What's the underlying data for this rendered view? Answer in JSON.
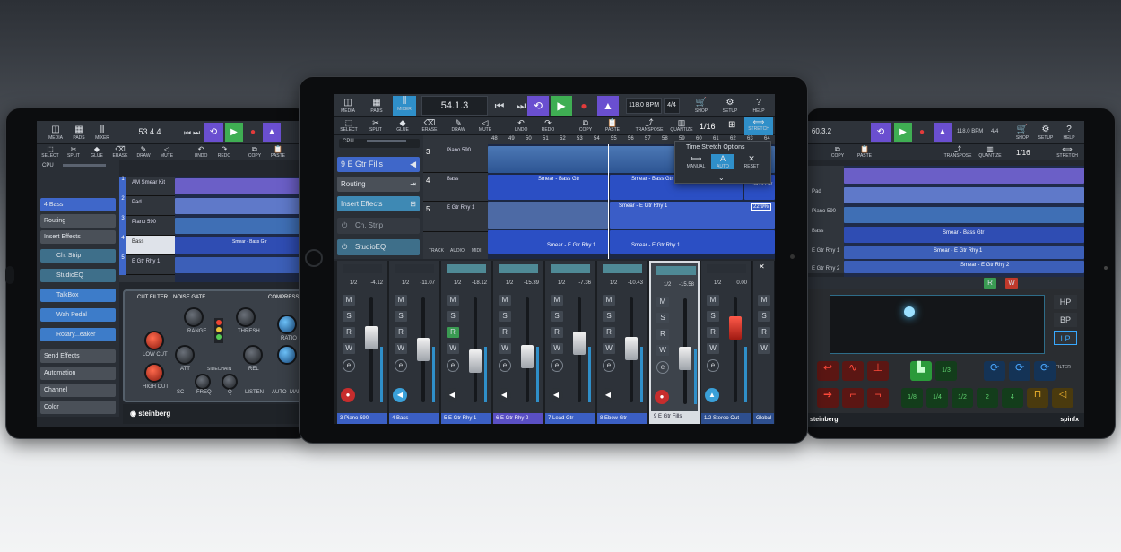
{
  "left": {
    "toolbar": [
      "MEDIA",
      "PADS",
      "MIXER"
    ],
    "position": "53.4.4",
    "tools": [
      "SELECT",
      "SPLIT",
      "GLUE",
      "ERASE",
      "DRAW",
      "MUTE",
      "UNDO",
      "REDO",
      "COPY",
      "PASTE"
    ],
    "cpu": "CPU",
    "track_header": "4 Bass",
    "side_items": [
      "Routing",
      "Insert Effects"
    ],
    "inserts": [
      "Ch. Strip",
      "StudioEQ",
      "TalkBox",
      "Wah Pedal",
      "Rotary...eaker"
    ],
    "side_bottom": [
      "Send Effects",
      "Automation",
      "Channel",
      "Color"
    ],
    "tracks": [
      {
        "num": "1",
        "name": "AM Smear Kit"
      },
      {
        "num": "2",
        "name": "Pad"
      },
      {
        "num": "3",
        "name": "Piano 590"
      },
      {
        "num": "4",
        "name": "Bass"
      },
      {
        "num": "5",
        "name": "E Gtr Rhy 1"
      }
    ],
    "clip_labels": [
      "Smear - Bass Gtr"
    ],
    "plugin_sections": [
      "CUT FILTER",
      "NOISE GATE",
      "COMPRESSOR"
    ],
    "plugin_labels": [
      "LOW CUT",
      "HIGH CUT",
      "RANGE",
      "THRESH",
      "ATT",
      "REL",
      "FREQ",
      "Q",
      "SC",
      "SIDECHAIN",
      "LISTEN",
      "RATIO",
      "AUTO",
      "MAKE"
    ],
    "brand": "steinberg"
  },
  "center": {
    "toolbar": [
      "MEDIA",
      "PADS",
      "MIXER"
    ],
    "position": "54.1.3",
    "tempo": "118.0 BPM",
    "signature": "4/4",
    "right_buttons": [
      "SHOP",
      "SETUP",
      "HELP"
    ],
    "tools": [
      "SELECT",
      "SPLIT",
      "GLUE",
      "ERASE",
      "DRAW",
      "MUTE",
      "UNDO",
      "REDO",
      "COPY",
      "PASTE",
      "TRANSPOSE",
      "QUANTIZE"
    ],
    "grid": "1/16",
    "stretch": "STRETCH",
    "cpu": "CPU",
    "ruler": [
      "48",
      "49",
      "50",
      "51",
      "52",
      "53",
      "54",
      "55",
      "56",
      "57",
      "58",
      "59",
      "60",
      "61",
      "62",
      "63",
      "64"
    ],
    "track_header": "9 E Gtr Fills",
    "side_items": [
      "Routing",
      "Insert Effects"
    ],
    "inserts": [
      "Ch. Strip",
      "StudioEQ"
    ],
    "tracks": [
      {
        "num": "3",
        "name": "Piano 590"
      },
      {
        "num": "4",
        "name": "Bass"
      },
      {
        "num": "5",
        "name": "E Gtr Rhy 1"
      }
    ],
    "bottom_tools": [
      "TRACK",
      "AUDIO",
      "MIDI"
    ],
    "clip_labels": [
      "Smear - Bass Gtr",
      "Smear - Bass Gtr",
      "Smear - Bass Gtr",
      "Smear - E Gtr Rhy 1",
      "Smear - E Gtr Rhy 1",
      "Smear - E Gtr Rhy 1"
    ],
    "stretch_value": "22.9%",
    "popup": {
      "title": "Time Stretch Options",
      "options": [
        "MANUAL",
        "AUTO",
        "RESET"
      ]
    },
    "channels": [
      {
        "name": "3  Piano 590",
        "pan": "1/2",
        "vol": "-4.12",
        "color": "#3b5fc4"
      },
      {
        "name": "4  Bass",
        "pan": "1/2",
        "vol": "-11.07",
        "color": "#3b5fc4"
      },
      {
        "name": "5  E Gtr Rhy 1",
        "pan": "1/2",
        "vol": "-18.12",
        "color": "#3b5fc4"
      },
      {
        "name": "6  E Gtr Rhy 2",
        "pan": "1/2",
        "vol": "-15.39",
        "color": "#5a4fc4"
      },
      {
        "name": "7  Lead Gtr",
        "pan": "1/2",
        "vol": "-7.36",
        "color": "#3b5fc4"
      },
      {
        "name": "8  Ebow Gtr",
        "pan": "1/2",
        "vol": "-10.43",
        "color": "#3b5fc4"
      },
      {
        "name": "9  E Gtr Fills",
        "pan": "1/2",
        "vol": "-15.58",
        "color": "#3b5fc4"
      },
      {
        "name": "1/2  Stereo Out",
        "pan": "1/2",
        "vol": "0.00",
        "color": "#2e4f8f"
      },
      {
        "name": "Global",
        "pan": "",
        "vol": "",
        "color": "#2e4f8f"
      }
    ]
  },
  "right": {
    "position": "60.3.2",
    "tempo": "118.0 BPM",
    "signature": "4/4",
    "right_buttons": [
      "SHOP",
      "SETUP",
      "HELP"
    ],
    "tools": [
      "COPY",
      "PASTE",
      "TRANSPOSE",
      "QUANTIZE",
      "STRETCH"
    ],
    "grid": "1/16",
    "tracks": [
      "Pad",
      "Piano 590",
      "Bass",
      "E Gtr Rhy 1",
      "E Gtr Rhy 2"
    ],
    "clip_labels": [
      "Smear - Bass Gtr",
      "Smear - E Gtr Rhy 1",
      "Smear - E Gtr Rhy 2"
    ],
    "filter_modes": [
      "HP",
      "BP",
      "LP"
    ],
    "filter_label": "FILTER",
    "pad_labels": [
      "1/3",
      "1/8",
      "1/4",
      "1/2",
      "2",
      "4"
    ],
    "brand": "steinberg",
    "brand2": "spinfx"
  }
}
